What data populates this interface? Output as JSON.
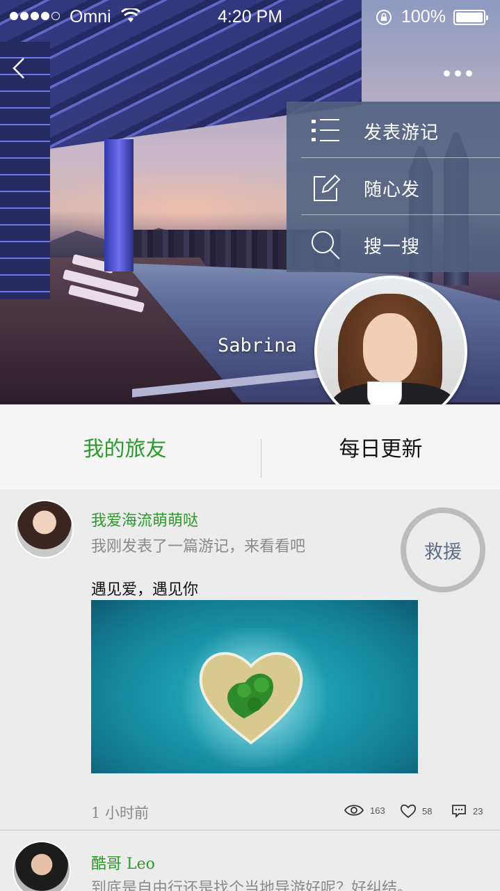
{
  "status_bar": {
    "carrier": "Omni",
    "time": "4:20 PM",
    "battery": "100%"
  },
  "header": {
    "username": "Sabrina"
  },
  "menu": {
    "items": [
      {
        "label": "发表游记",
        "icon": "list-icon"
      },
      {
        "label": "随心发",
        "icon": "edit-icon"
      },
      {
        "label": "搜一搜",
        "icon": "search-icon"
      }
    ]
  },
  "tabs": [
    {
      "label": "我的旅友",
      "active": true
    },
    {
      "label": "每日更新",
      "active": false
    }
  ],
  "rescue_button": {
    "label": "救援"
  },
  "posts": [
    {
      "author": "我爱海流萌萌哒",
      "subtitle": "我刚发表了一篇游记，来看看吧",
      "title": "遇见爱，遇见你",
      "time": "1 小时前",
      "views": "163",
      "likes": "58",
      "comments": "23"
    },
    {
      "author": "酷哥 Leo",
      "subtitle": "到底是自由行还是找个当地导游好呢？好纠结。"
    }
  ],
  "colors": {
    "accent_green": "#2a9a2a",
    "menu_bg": "#506080",
    "rescue_text": "#5f6e88"
  }
}
